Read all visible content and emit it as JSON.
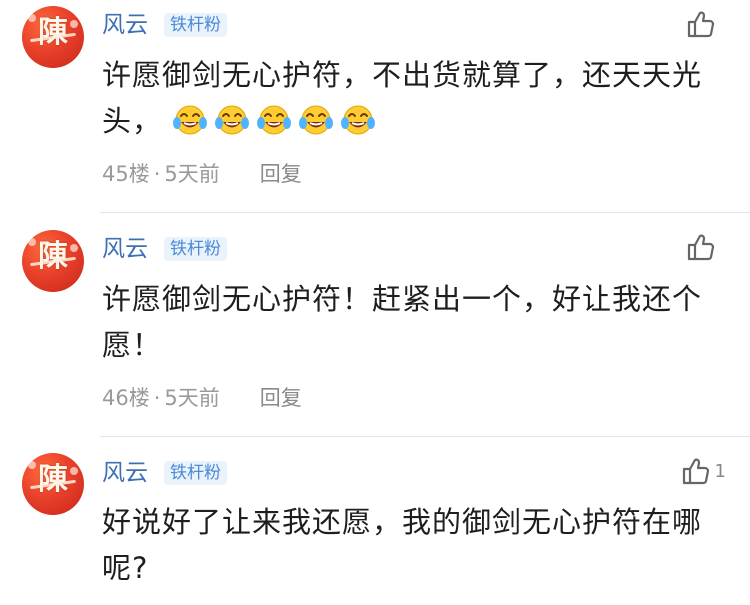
{
  "comments": [
    {
      "username": "风云",
      "badge": "铁杆粉",
      "text": "许愿御剑无心护符，不出货就算了，还天天光头，",
      "emoji_count": 5,
      "floor": "45楼",
      "separator": "·",
      "time": "5天前",
      "reply": "回复",
      "likes": ""
    },
    {
      "username": "风云",
      "badge": "铁杆粉",
      "text": "许愿御剑无心护符！赶紧出一个，好让我还个愿！",
      "emoji_count": 0,
      "floor": "46楼",
      "separator": "·",
      "time": "5天前",
      "reply": "回复",
      "likes": ""
    },
    {
      "username": "风云",
      "badge": "铁杆粉",
      "text": "好说好了让来我还愿，我的御剑无心护符在哪呢?",
      "emoji_count": 0,
      "floor": "",
      "separator": "",
      "time": "",
      "reply": "",
      "likes": "1"
    }
  ],
  "icons": {
    "like": "thumbs-up-icon",
    "emoji": "tears-of-joy-emoji"
  },
  "colors": {
    "username": "#3d6fb5",
    "badge_text": "#4a8ad8",
    "badge_bg": "#eaf2fb",
    "meta": "#9a9a9a",
    "avatar": "#e8402a"
  }
}
